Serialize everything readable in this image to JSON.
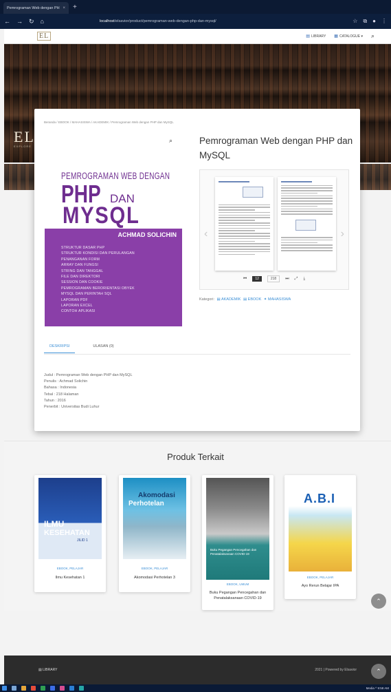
{
  "browser": {
    "tab_title": "Pemrograman Web dengan PH",
    "tab_close": "×",
    "new_tab": "+",
    "url_host": "localhost",
    "url_path": "/elsavior/product/pemrograman-web-dengan-php-dan-mysql/"
  },
  "header": {
    "logo": "EL",
    "nav_library": "LIBRARY",
    "nav_catalogue": "CATALOGUE ▾"
  },
  "hero": {
    "letters": "EL",
    "sub": "EXPLORE"
  },
  "breadcrumb": "Beranda / EBOOK / MAHASISWA / AKADEMIK / Pemrograman Web dengan PHP dan MySQL",
  "product": {
    "title": "Pemrograman Web dengan PHP dan MySQL",
    "cover": {
      "title_small": "PEMROGRAMAN WEB DENGAN",
      "php": "PHP",
      "dan": "DAN",
      "mysql": "MYSQL",
      "author": "ACHMAD SOLICHIN",
      "toc": [
        "STRUKTUR DASAR PHP",
        "STRUKTUR KONDISI DAN PERULANGAN",
        "PENANGANAN FORM",
        "ARRAY DAN FUNGSI",
        "STRING DAN TANGGAL",
        "FILE DAN DIREKTORI",
        "SESSION DAN COOKIE",
        "PEMROGRAMAN BERORIENTASI OBYEK",
        "MYSQL DAN PERINTAH SQL",
        "LAPORAN PDF",
        "LAPORAN EXCEL",
        "CONTOH APLIKASI"
      ]
    },
    "viewer": {
      "page": "12",
      "total": "218",
      "prev": "‹",
      "next": "›"
    },
    "kategori_label": "Kategori:",
    "categories": [
      "AKADEMIK",
      "EBOOK",
      "MAHASISWA"
    ],
    "tabs": [
      "DESKRIPSI",
      "ULASAN (0)"
    ],
    "details": [
      "Judul : Pemrograman Web dengan PHP dan MySQL",
      "Penulis : Achmad Solichin",
      "Bahasa : Indonesia",
      "Tebal : 218 Halaman",
      "Tahun : 2016",
      "Penerbit : Universitas Budi Luhur"
    ]
  },
  "related": {
    "title": "Produk Terkait",
    "items": [
      {
        "name": "Ilmu Kesehatan 1",
        "cats": "EBOOK, PELAJAR",
        "cover_title": "ILMU",
        "cover_sub": "KESEHATAN",
        "cover_note": "JILID 1"
      },
      {
        "name": "Akomodasi Perhotelan 3",
        "cats": "EBOOK, PELAJAR",
        "cover_title": "Akomodasi",
        "cover_sub": "Perhotelan"
      },
      {
        "name": "Buku Pegangan Pencegahan dan Penatalaksanaan COVID-19",
        "cats": "EBOOK, UMUM",
        "cover_title": "Buku Pegangan Pencegahan dan Penatalaksanaan COVID-19"
      },
      {
        "name": "Ayo Rerun Belajar IPA",
        "cats": "EBOOK, PELAJAR",
        "cover_title": "A.B.I"
      }
    ]
  },
  "footer": {
    "left": "LIBRARY",
    "right": "2021 | Powered by Elsavior"
  },
  "taskbar": {
    "clock": "Media  ^  9:58 AM"
  },
  "colors": {
    "accent": "#3b8fd6",
    "cover_purple": "#8a3fa8",
    "footer": "#2c2c2c"
  }
}
